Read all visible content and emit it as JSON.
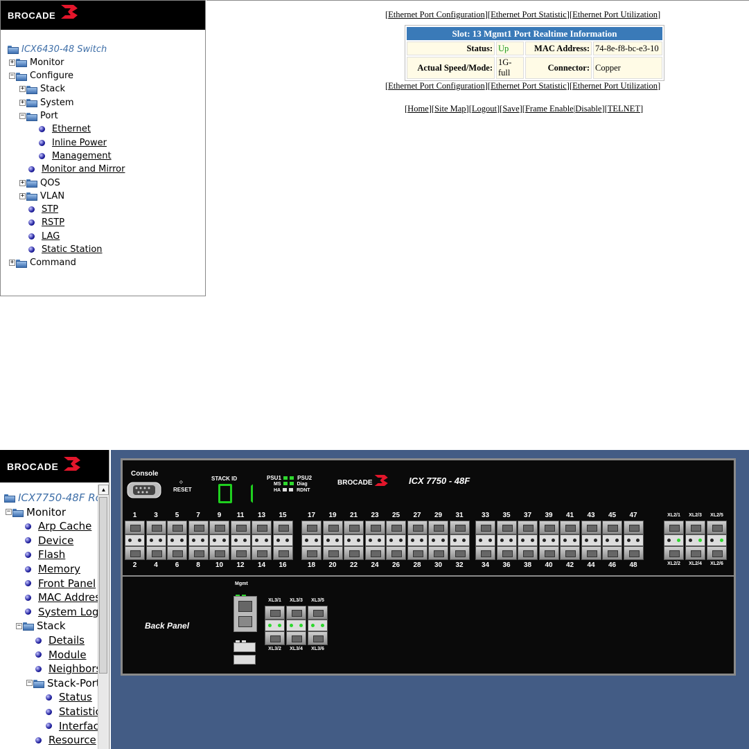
{
  "top": {
    "logo": "BROCADE",
    "tree": {
      "root": "ICX6430-48 Switch",
      "items": [
        {
          "label": "Monitor",
          "type": "folder",
          "expander": "+"
        },
        {
          "label": "Configure",
          "type": "folder",
          "expander": "-"
        },
        {
          "label": "Stack",
          "type": "folder",
          "expander": "+"
        },
        {
          "label": "System",
          "type": "folder",
          "expander": "+"
        },
        {
          "label": "Port",
          "type": "folder",
          "expander": "-"
        },
        {
          "label": "Ethernet",
          "type": "link"
        },
        {
          "label": "Inline Power",
          "type": "link"
        },
        {
          "label": "Management",
          "type": "link"
        },
        {
          "label": "Monitor and Mirror",
          "type": "link"
        },
        {
          "label": "QOS",
          "type": "folder",
          "expander": "+"
        },
        {
          "label": "VLAN",
          "type": "folder",
          "expander": "+"
        },
        {
          "label": "STP",
          "type": "link"
        },
        {
          "label": "RSTP",
          "type": "link"
        },
        {
          "label": "LAG",
          "type": "link"
        },
        {
          "label": "Static Station",
          "type": "link"
        },
        {
          "label": "Command",
          "type": "folder",
          "expander": "+"
        }
      ]
    },
    "port_links": [
      "Ethernet Port Configuration",
      "Ethernet Port Statistic",
      "Ethernet Port Utilization"
    ],
    "table": {
      "title": "Slot: 13 Mgmt1 Port Realtime Information",
      "status_label": "Status:",
      "status_value": "Up",
      "mac_label": "MAC Address:",
      "mac_value": "74-8e-f8-bc-e3-10",
      "speed_label": "Actual Speed/Mode:",
      "speed_value": "1G-full",
      "connector_label": "Connector:",
      "connector_value": "Copper"
    },
    "bottom_links": [
      "Home",
      "Site Map",
      "Logout",
      "Save",
      "Frame Enable",
      "Disable",
      "TELNET"
    ]
  },
  "bottom": {
    "logo": "BROCADE",
    "tree": {
      "root": "ICX7750-48F Ro",
      "items": [
        {
          "label": "Monitor",
          "type": "folder",
          "expander": "-"
        },
        {
          "label": "Arp Cache",
          "type": "link"
        },
        {
          "label": "Device",
          "type": "link"
        },
        {
          "label": "Flash",
          "type": "link"
        },
        {
          "label": "Memory",
          "type": "link"
        },
        {
          "label": "Front Panel",
          "type": "link"
        },
        {
          "label": "MAC Addres",
          "type": "link"
        },
        {
          "label": "System Log",
          "type": "link"
        },
        {
          "label": "Stack",
          "type": "folder",
          "expander": "-"
        },
        {
          "label": "Details",
          "type": "link"
        },
        {
          "label": "Module",
          "type": "link"
        },
        {
          "label": "Neighbors",
          "type": "link"
        },
        {
          "label": "Stack-Port",
          "type": "folder",
          "expander": "-"
        },
        {
          "label": "Status",
          "type": "link"
        },
        {
          "label": "Statistics",
          "type": "link"
        },
        {
          "label": "Interface",
          "type": "link"
        },
        {
          "label": "Resource",
          "type": "link"
        }
      ]
    },
    "chassis": {
      "console": "Console",
      "reset": "RESET",
      "stack_id_label": "STACK ID",
      "stack_id": "01",
      "psu1": "PSU1",
      "psu2": "PSU2",
      "ms": "MS",
      "ha": "HA",
      "diag": "Diag",
      "rdnt": "RDNT",
      "brand": "BROCADE",
      "model": "ICX 7750 - 48F",
      "top_ports": [
        "1",
        "3",
        "5",
        "7",
        "9",
        "11",
        "13",
        "15",
        "17",
        "19",
        "21",
        "23",
        "25",
        "27",
        "29",
        "31",
        "33",
        "35",
        "37",
        "39",
        "41",
        "43",
        "45",
        "47"
      ],
      "bottom_ports": [
        "2",
        "4",
        "6",
        "8",
        "10",
        "12",
        "14",
        "16",
        "18",
        "20",
        "22",
        "24",
        "26",
        "28",
        "30",
        "32",
        "34",
        "36",
        "38",
        "40",
        "42",
        "44",
        "46",
        "48"
      ],
      "xl2_top": [
        "XL2/1",
        "XL2/3",
        "XL2/5"
      ],
      "xl2_bottom": [
        "XL2/2",
        "XL2/4",
        "XL2/6"
      ],
      "back_panel": "Back Panel",
      "mgmt": "Mgmt",
      "xl3_top": [
        "XL3/1",
        "XL3/3",
        "XL3/5"
      ],
      "xl3_bottom": [
        "XL3/2",
        "XL3/4",
        "XL3/6"
      ]
    }
  }
}
